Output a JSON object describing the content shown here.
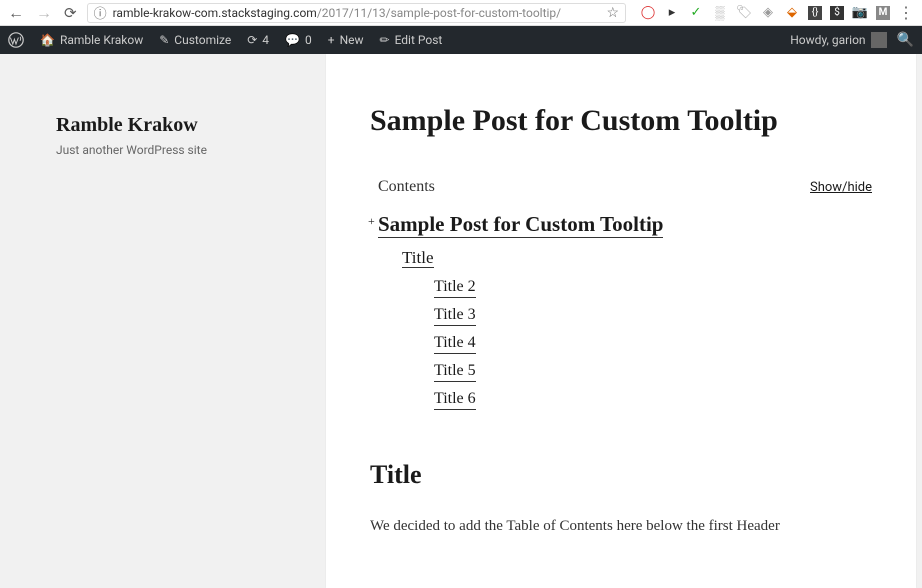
{
  "browser": {
    "url_host": "ramble-krakow-com.stackstaging.com",
    "url_path": "/2017/11/13/sample-post-for-custom-tooltip/"
  },
  "wp_bar": {
    "site_name": "Ramble Krakow",
    "customize": "Customize",
    "update_count": "4",
    "comment_count": "0",
    "new_label": "New",
    "edit_label": "Edit Post",
    "howdy": "Howdy, garion"
  },
  "sidebar": {
    "site_title": "Ramble Krakow",
    "tagline": "Just another WordPress site"
  },
  "post": {
    "title": "Sample Post for Custom Tooltip",
    "toc": {
      "label": "Contents",
      "toggle": "Show/hide",
      "main_link": "Sample Post for Custom Tooltip",
      "l2": "Title",
      "l3_items": [
        "Title 2",
        "Title 3",
        "Title 4",
        "Title 5",
        "Title 6"
      ]
    },
    "section_heading": "Title",
    "body_p1": "We decided to add the Table of Contents here below the first Header"
  }
}
